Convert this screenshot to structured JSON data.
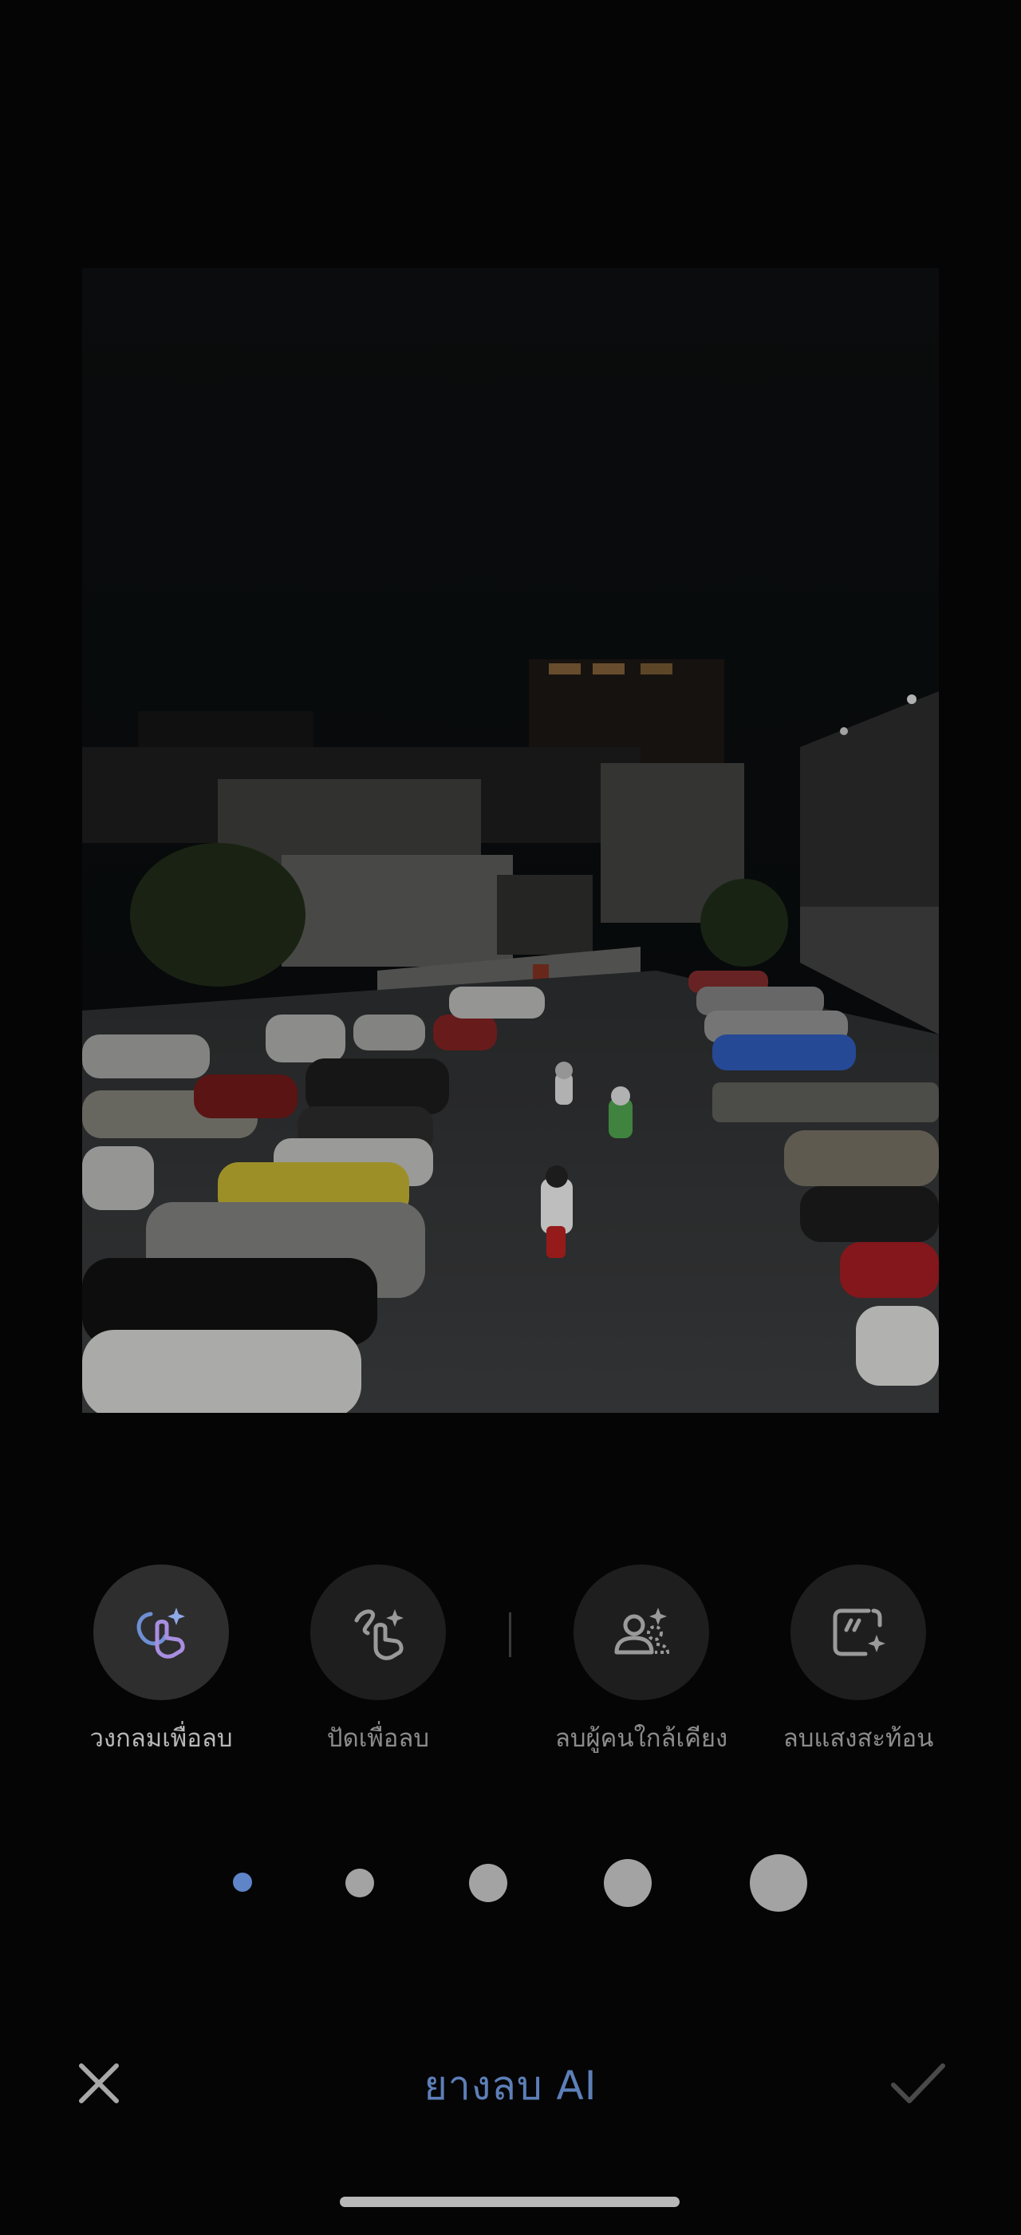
{
  "tools": [
    {
      "label": "วงกลมเพื่อลบ",
      "icon": "circle-to-erase-icon",
      "active": true
    },
    {
      "label": "ปัดเพื่อลบ",
      "icon": "brush-to-erase-icon",
      "active": false
    },
    {
      "label": "ลบผู้คนใกล้เคียง",
      "icon": "remove-people-icon",
      "active": false
    },
    {
      "label": "ลบแสงสะท้อน",
      "icon": "remove-reflection-icon",
      "active": false
    }
  ],
  "brush_sizes": {
    "count": 5,
    "selected_index": 0
  },
  "bottom_bar": {
    "title": "ยางลบ AI",
    "close_icon": "close-icon",
    "confirm_icon": "check-icon"
  },
  "colors": {
    "background": "#050505",
    "accent": "#5f85c8",
    "selected_dot": "#5f85c8"
  }
}
